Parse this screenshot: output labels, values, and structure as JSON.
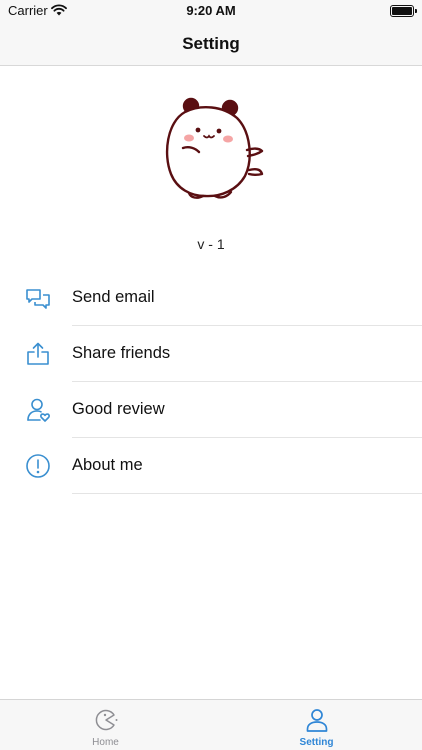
{
  "status_bar": {
    "carrier": "Carrier",
    "time": "9:20 AM"
  },
  "nav": {
    "title": "Setting"
  },
  "version": "v - 1",
  "menu": [
    {
      "label": "Send email",
      "icon": "chat-bubbles-icon"
    },
    {
      "label": "Share friends",
      "icon": "share-icon"
    },
    {
      "label": "Good review",
      "icon": "user-heart-icon"
    },
    {
      "label": "About me",
      "icon": "info-circle-icon"
    }
  ],
  "tabbar": {
    "tabs": [
      {
        "label": "Home",
        "icon": "pacman-icon",
        "selected": false
      },
      {
        "label": "Setting",
        "icon": "person-icon",
        "selected": true
      }
    ]
  },
  "colors": {
    "accent": "#2f86d6",
    "icon_blue": "#3a8fd0",
    "mascot_outline": "#5a0f12",
    "blush": "#f5a5a5"
  }
}
